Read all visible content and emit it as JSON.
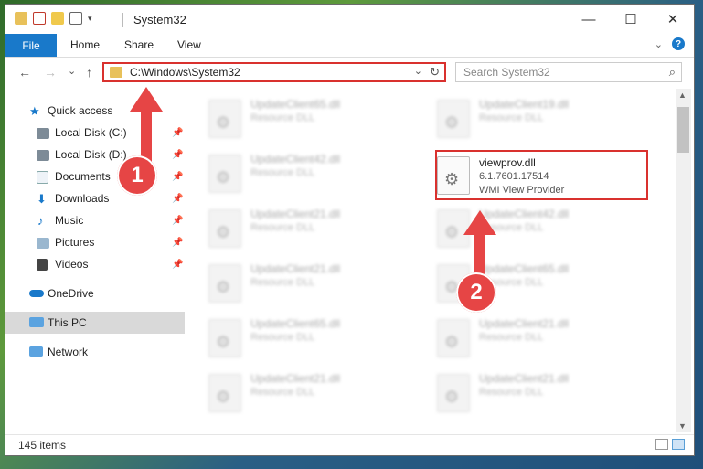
{
  "window": {
    "title": "System32",
    "controls": {
      "minimize": "—",
      "maximize": "☐",
      "close": "✕"
    }
  },
  "ribbon": {
    "file": "File",
    "tabs": [
      "Home",
      "Share",
      "View"
    ],
    "expand_icon": "chevron-down-icon",
    "help_label": "?"
  },
  "nav": {
    "back": "←",
    "forward": "→",
    "recent": "⌄",
    "up": "↑"
  },
  "address": {
    "path": "C:\\Windows\\System32",
    "dropdown": "⌄",
    "refresh": "↻"
  },
  "search": {
    "placeholder": "Search System32",
    "icon": "⌕"
  },
  "sidebar": {
    "items": [
      {
        "label": "Quick access",
        "icon": "star-icon",
        "pinned": false
      },
      {
        "label": "Local Disk (C:)",
        "icon": "drive-icon",
        "pinned": true
      },
      {
        "label": "Local Disk (D:)",
        "icon": "drive-icon",
        "pinned": true
      },
      {
        "label": "Documents",
        "icon": "documents-icon",
        "pinned": true
      },
      {
        "label": "Downloads",
        "icon": "downloads-icon",
        "pinned": true
      },
      {
        "label": "Music",
        "icon": "music-icon",
        "pinned": true
      },
      {
        "label": "Pictures",
        "icon": "pictures-icon",
        "pinned": true
      },
      {
        "label": "Videos",
        "icon": "videos-icon",
        "pinned": true
      },
      {
        "label": "OneDrive",
        "icon": "cloud-icon",
        "pinned": false
      },
      {
        "label": "This PC",
        "icon": "computer-icon",
        "pinned": false,
        "selected": true
      },
      {
        "label": "Network",
        "icon": "network-icon",
        "pinned": false
      }
    ]
  },
  "files": {
    "left_column": [
      {
        "name": "UpdateClient65.dll",
        "type": "Resource DLL"
      },
      {
        "name": "UpdateClient42.dll",
        "type": "Resource DLL"
      },
      {
        "name": "UpdateClient21.dll",
        "type": "Resource DLL"
      },
      {
        "name": "UpdateClient21.dll",
        "type": "Resource DLL"
      },
      {
        "name": "UpdateClient65.dll",
        "type": "Resource DLL"
      },
      {
        "name": "UpdateClient21.dll",
        "type": "Resource DLL"
      }
    ],
    "right_column": [
      {
        "name": "UpdateClient19.dll",
        "type": "Resource DLL"
      },
      {
        "name": "viewprov.dll",
        "version": "6.1.7601.17514",
        "type": "WMI View Provider",
        "highlighted": true
      },
      {
        "name": "UpdateClient42.dll",
        "type": "Resource DLL"
      },
      {
        "name": "UpdateClient65.dll",
        "type": "Resource DLL"
      },
      {
        "name": "UpdateClient21.dll",
        "type": "Resource DLL"
      },
      {
        "name": "UpdateClient21.dll",
        "type": "Resource DLL"
      }
    ]
  },
  "status": {
    "count": "145 items"
  },
  "callouts": {
    "one": "1",
    "two": "2"
  },
  "colors": {
    "accent": "#1979ca",
    "highlight": "#d9312e",
    "callout": "#e64545"
  }
}
